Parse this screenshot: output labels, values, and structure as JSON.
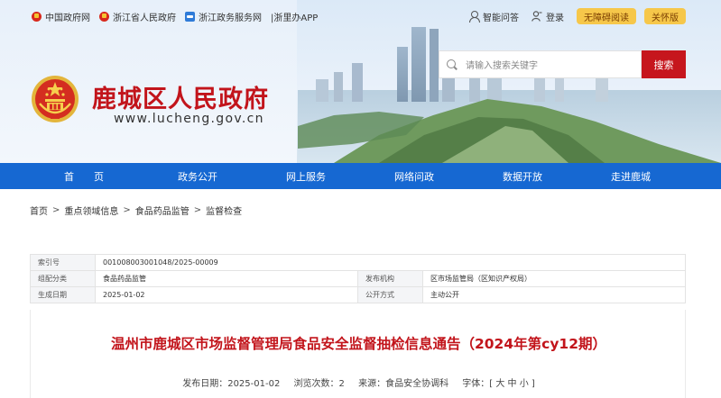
{
  "toplinks": [
    {
      "label": "中国政府网",
      "icon": "national-emblem-icon"
    },
    {
      "label": "浙江省人民政府",
      "icon": "national-emblem-icon"
    },
    {
      "label": "浙江政务服务网",
      "icon": "zjzwfw-icon"
    },
    {
      "label": "|浙里办APP",
      "icon": ""
    }
  ],
  "header_right": {
    "qa_label": "智能问答",
    "login_label": "登录",
    "accessible_label": "无障碍阅读",
    "care_label": "关怀版"
  },
  "search": {
    "placeholder": "请输入搜索关键字",
    "button_label": "搜索"
  },
  "site": {
    "title": "鹿城区人民政府",
    "url": "www.lucheng.gov.cn"
  },
  "nav": [
    "首　　页",
    "政务公开",
    "网上服务",
    "网络问政",
    "数据开放",
    "走进鹿城"
  ],
  "breadcrumb": [
    "首页",
    "重点领域信息",
    "食品药品监管",
    "监督检查"
  ],
  "info": {
    "index_label": "索引号",
    "index_value": "001008003001048/2025-00009",
    "category_label": "组配分类",
    "category_value": "食品药品监管",
    "issuer_label": "发布机构",
    "issuer_value": "区市场监管局（区知识产权局）",
    "date_label": "生成日期",
    "date_value": "2025-01-02",
    "disclosure_label": "公开方式",
    "disclosure_value": "主动公开"
  },
  "article": {
    "title": "温州市鹿城区市场监督管理局食品安全监督抽检信息通告（2024年第cy12期）",
    "publish": "发布日期：2025-01-02",
    "views": "浏览次数：2",
    "source": "来源：食品安全协调科",
    "fontsize": "字体：[ 大 中 小 ]"
  },
  "colors": {
    "brand_red": "#c2141b",
    "nav_blue": "#1668d2",
    "pill_yellow": "#f6c74a"
  }
}
